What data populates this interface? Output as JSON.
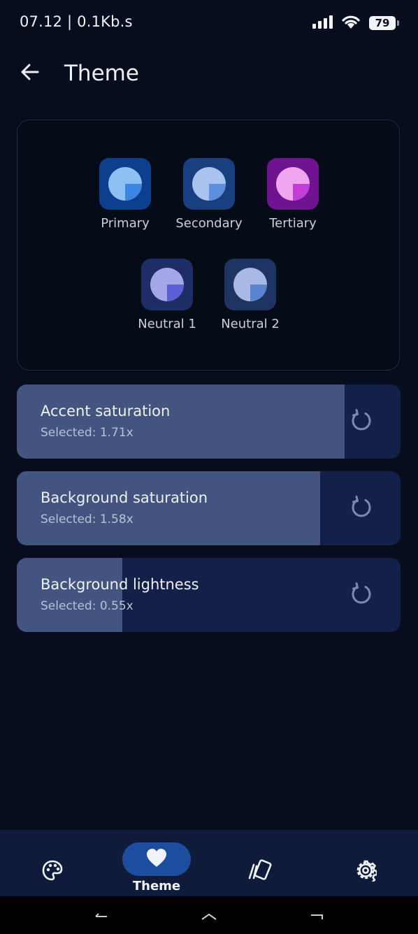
{
  "status_bar": {
    "time_speed": "07.12 | 0.1Kb.s",
    "battery": "79",
    "icons": [
      "signal-icon",
      "wifi-icon",
      "battery-icon"
    ]
  },
  "app_bar": {
    "back_icon": "arrow-left-icon",
    "title": "Theme"
  },
  "palette": {
    "swatches": [
      {
        "label": "Primary",
        "tile_color": "#0d3f8f",
        "light": "#8fc0f4",
        "dark": "#3a86e0"
      },
      {
        "label": "Secondary",
        "tile_color": "#1a3f80",
        "light": "#a9c3ee",
        "dark": "#5c8fdc"
      },
      {
        "label": "Tertiary",
        "tile_color": "#6f1391",
        "light": "#f0a6ee",
        "dark": "#c33ed6"
      },
      {
        "label": "Neutral 1",
        "tile_color": "#1d2d66",
        "light": "#a3a7e8",
        "dark": "#5b5fd4"
      },
      {
        "label": "Neutral 2",
        "tile_color": "#1e3564",
        "light": "#a9b9e6",
        "dark": "#5a84d0"
      }
    ]
  },
  "sliders": [
    {
      "title": "Accent saturation",
      "selected": "Selected: 1.71x",
      "fill_fraction": 0.855
    },
    {
      "title": "Background saturation",
      "selected": "Selected: 1.58x",
      "fill_fraction": 0.79
    },
    {
      "title": "Background lightness",
      "selected": "Selected: 0.55x",
      "fill_fraction": 0.275
    }
  ],
  "reset_icon": "reset-icon",
  "bottom_nav": {
    "items": [
      {
        "icon": "palette-icon",
        "label": ""
      },
      {
        "icon": "heart-icon",
        "label": "Theme",
        "active": true
      },
      {
        "icon": "cards-icon",
        "label": ""
      },
      {
        "icon": "gear-icon",
        "label": ""
      }
    ]
  },
  "system_nav": {
    "back": "back-key",
    "home": "home-key",
    "recents": "recents-key"
  },
  "colors": {
    "background": "#070d1c",
    "active_nav_pill": "#1c4d9e",
    "slider_fill": "#445480",
    "slider_track": "#13204a"
  }
}
